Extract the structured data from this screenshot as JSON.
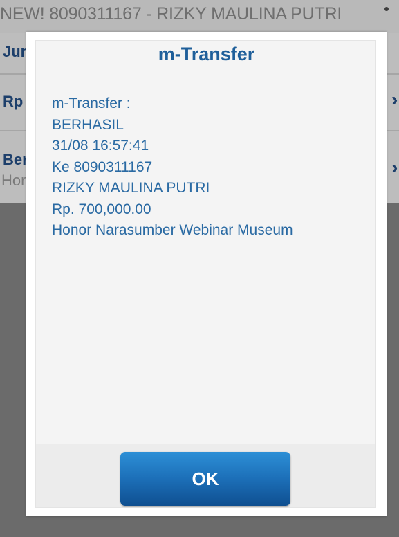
{
  "background": {
    "header_title": "NEW! 8090311167 - RIZKY MAULINA PUTRI",
    "rows": [
      {
        "label": "Jun",
        "sub": ""
      },
      {
        "label": "Rp",
        "sub": ""
      },
      {
        "label": "Ber",
        "sub": "Hon"
      }
    ],
    "chevron": "›"
  },
  "dialog": {
    "title": "m-Transfer",
    "message_lines": [
      "m-Transfer :",
      "BERHASIL",
      "31/08 16:57:41",
      "Ke 8090311167",
      "RIZKY MAULINA PUTRI",
      "Rp. 700,000.00",
      "Honor Narasumber Webinar Museum"
    ],
    "ok_label": "OK"
  },
  "colors": {
    "accent": "#1f5f9a",
    "button": "#1c6fb8",
    "overlay": "#6d6d6d"
  }
}
